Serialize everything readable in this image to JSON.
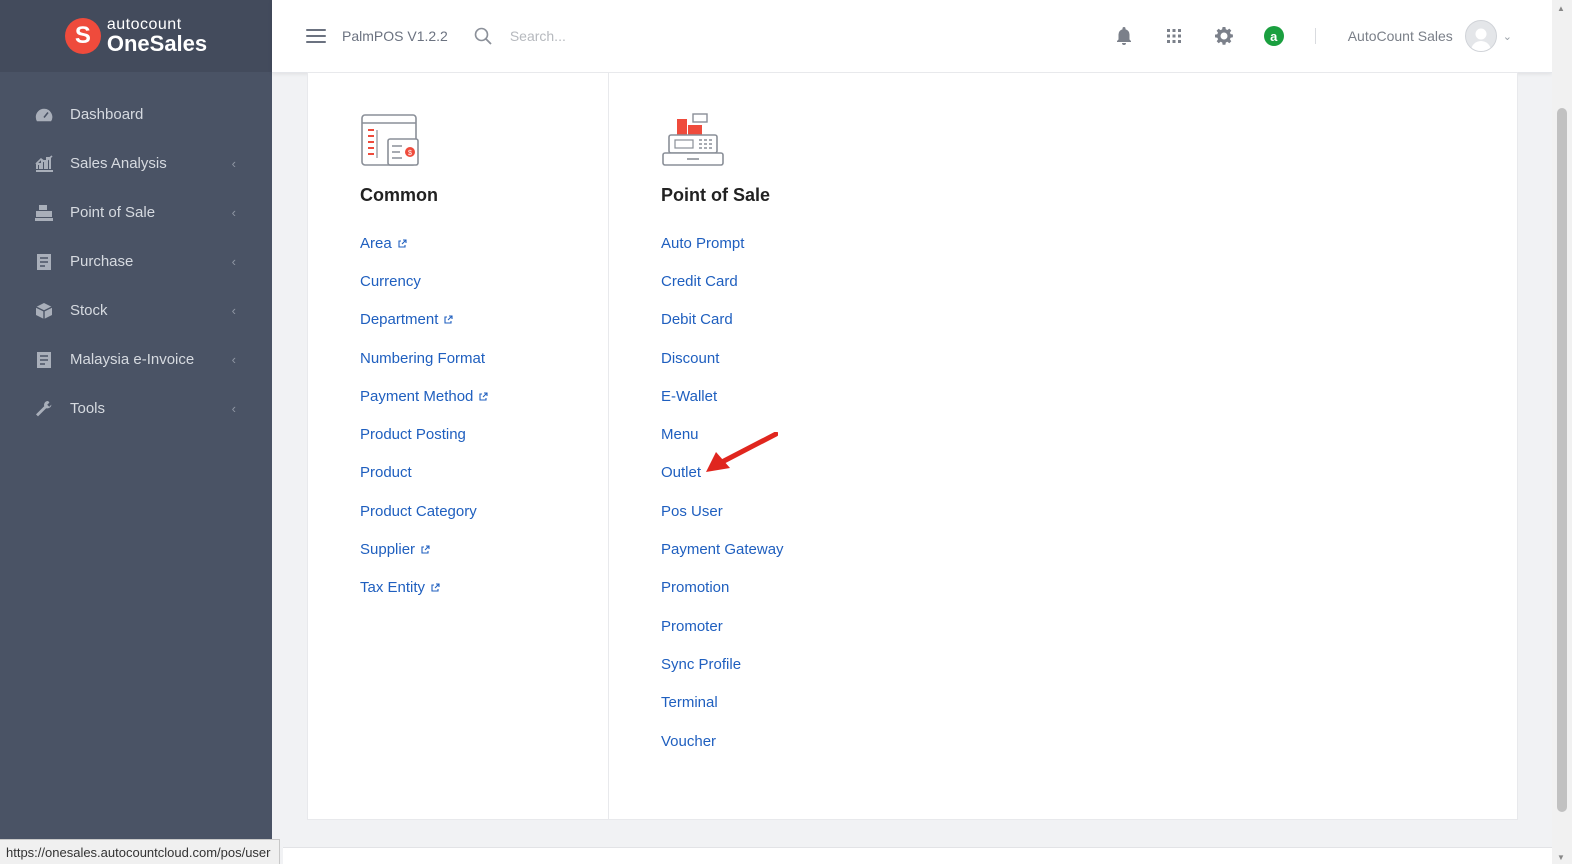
{
  "brand": {
    "badge_letter": "S",
    "top": "autocount",
    "bottom": "OneSales",
    "badge_color": "#ef4b3c"
  },
  "sidebar": {
    "items": [
      {
        "label": "Dashboard",
        "icon": "dashboard-icon",
        "has_submenu": false
      },
      {
        "label": "Sales Analysis",
        "icon": "chart-icon",
        "has_submenu": true
      },
      {
        "label": "Point of Sale",
        "icon": "cash-register-icon",
        "has_submenu": true
      },
      {
        "label": "Purchase",
        "icon": "receipt-icon",
        "has_submenu": true
      },
      {
        "label": "Stock",
        "icon": "box-icon",
        "has_submenu": true
      },
      {
        "label": "Malaysia e-Invoice",
        "icon": "invoice-icon",
        "has_submenu": true
      },
      {
        "label": "Tools",
        "icon": "wrench-icon",
        "has_submenu": true
      }
    ],
    "chevron": "‹"
  },
  "header": {
    "version": "PalmPOS V1.2.2",
    "search_placeholder": "Search...",
    "user_name": "AutoCount Sales",
    "app_badge_letter": "a",
    "app_badge_color": "#1a9f3f"
  },
  "common": {
    "title": "Common",
    "links": [
      {
        "label": "Area",
        "external": true
      },
      {
        "label": "Currency",
        "external": false
      },
      {
        "label": "Department",
        "external": true
      },
      {
        "label": "Numbering Format",
        "external": false
      },
      {
        "label": "Payment Method",
        "external": true
      },
      {
        "label": "Product Posting",
        "external": false
      },
      {
        "label": "Product",
        "external": false
      },
      {
        "label": "Product Category",
        "external": false
      },
      {
        "label": "Supplier",
        "external": true
      },
      {
        "label": "Tax Entity",
        "external": true
      }
    ]
  },
  "pos": {
    "title": "Point of Sale",
    "links": [
      {
        "label": "Auto Prompt"
      },
      {
        "label": "Credit Card"
      },
      {
        "label": "Debit Card"
      },
      {
        "label": "Discount"
      },
      {
        "label": "E-Wallet"
      },
      {
        "label": "Menu"
      },
      {
        "label": "Outlet"
      },
      {
        "label": "Pos User"
      },
      {
        "label": "Payment Gateway"
      },
      {
        "label": "Promotion"
      },
      {
        "label": "Promoter"
      },
      {
        "label": "Sync Profile"
      },
      {
        "label": "Terminal"
      },
      {
        "label": "Voucher"
      }
    ]
  },
  "status_bar": {
    "url": "https://onesales.autocountcloud.com/pos/user"
  },
  "colors": {
    "sidebar_bg": "#4a5365",
    "link": "#1f5fbf",
    "annotation_arrow": "#e0261e"
  }
}
